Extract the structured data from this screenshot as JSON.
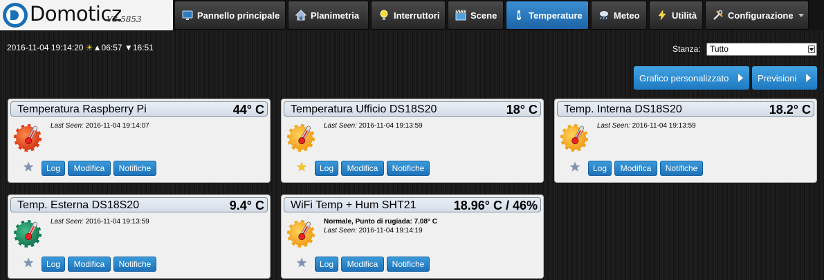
{
  "brand": {
    "name": "Domoticz",
    "version": "V3.5853"
  },
  "nav": [
    {
      "label": "Pannello principale",
      "icon": "monitor-icon",
      "active": false
    },
    {
      "label": "Planimetria",
      "icon": "house-icon",
      "active": false
    },
    {
      "label": "Interruttori",
      "icon": "lightbulb-icon",
      "active": false
    },
    {
      "label": "Scene",
      "icon": "clapperboard-icon",
      "active": false
    },
    {
      "label": "Temperature",
      "icon": "thermometer-icon",
      "active": true
    },
    {
      "label": "Meteo",
      "icon": "rain-cloud-icon",
      "active": false
    },
    {
      "label": "Utilità",
      "icon": "lightning-icon",
      "active": false
    },
    {
      "label": "Configurazione",
      "icon": "tools-icon",
      "active": false
    }
  ],
  "info": {
    "datetime": "2016-11-04 19:14:20",
    "sunrise": "06:57",
    "sunset": "16:51"
  },
  "room": {
    "label": "Stanza:",
    "selected": "Tutto"
  },
  "actions": {
    "custom_chart": "Grafico personalizzato",
    "forecast": "Previsioni"
  },
  "card_buttons": {
    "log": "Log",
    "edit": "Modifica",
    "notifications": "Notifiche"
  },
  "last_seen_label": "Last Seen:",
  "colors": {
    "accent": "#1e79c2",
    "hot_icon": "#e23a10",
    "warm_icon": "#f2a20f",
    "cool_icon": "#0f7b52"
  },
  "devices": [
    {
      "name": "Temperatura Raspberry Pi",
      "value": "44° C",
      "last_seen": "2016-11-04 19:14:07",
      "favorite": false,
      "icon": "temperature-hot-icon",
      "status": ""
    },
    {
      "name": "Temperatura Ufficio DS18S20",
      "value": "18° C",
      "last_seen": "2016-11-04 19:13:59",
      "favorite": true,
      "icon": "temperature-warm-icon",
      "status": ""
    },
    {
      "name": "Temp. Interna DS18S20",
      "value": "18.2° C",
      "last_seen": "2016-11-04 19:13:59",
      "favorite": false,
      "icon": "temperature-warm-icon",
      "status": ""
    },
    {
      "name": "Temp. Esterna DS18S20",
      "value": "9.4° C",
      "last_seen": "2016-11-04 19:13:59",
      "favorite": false,
      "icon": "temperature-cool-icon",
      "status": ""
    },
    {
      "name": "WiFi Temp + Hum SHT21",
      "value": "18.96° C / 46%",
      "last_seen": "2016-11-04 19:14:19",
      "favorite": false,
      "icon": "temperature-warm-icon",
      "status": "Normale, Punto di rugiada: 7.08° C"
    }
  ]
}
